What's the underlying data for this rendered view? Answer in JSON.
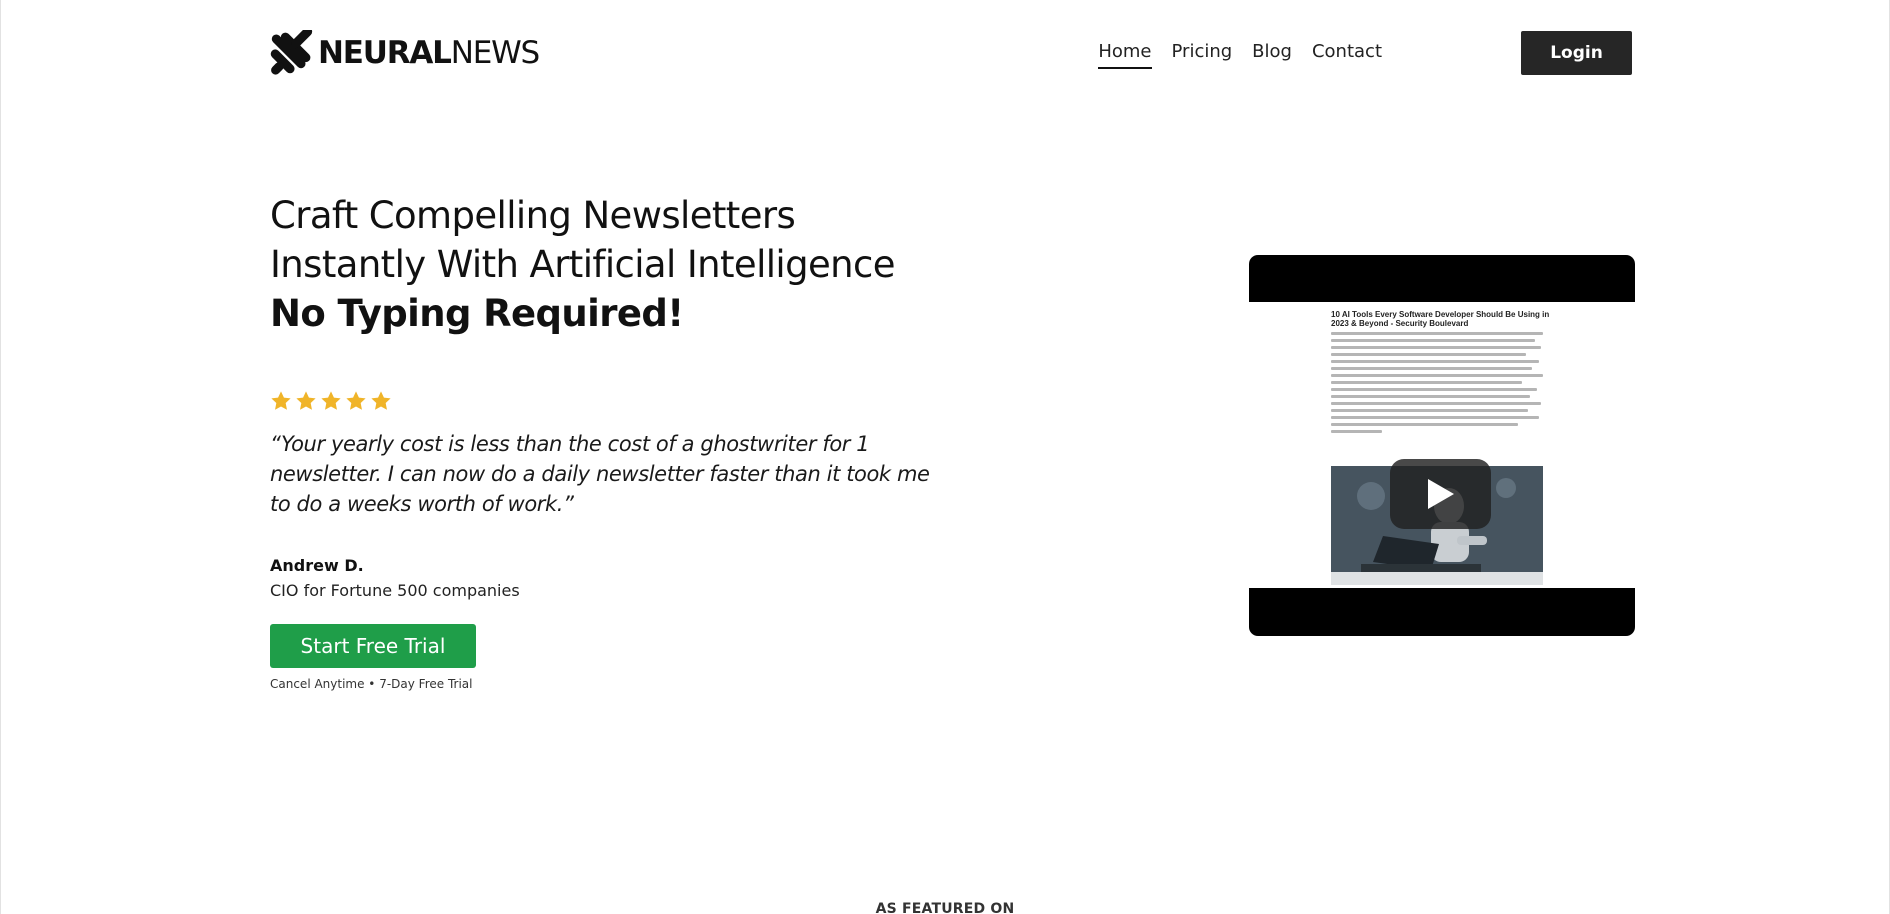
{
  "header": {
    "logo_text_strong": "NEURAL",
    "logo_text_light": "NEWS",
    "nav": [
      {
        "label": "Home",
        "active": true
      },
      {
        "label": "Pricing",
        "active": false
      },
      {
        "label": "Blog",
        "active": false
      },
      {
        "label": "Contact",
        "active": false
      }
    ],
    "login_label": "Login"
  },
  "hero": {
    "headline_line1": "Craft Compelling Newsletters",
    "headline_line2": "Instantly With Artificial Intelligence",
    "headline_emphasis": "No Typing Required!",
    "rating_stars": 5,
    "star_color": "#f0b429",
    "quote": "“Your yearly cost is less than the cost of a ghostwriter for 1 newsletter. I can now do a daily newsletter faster than it took me to do a weeks worth of work.”",
    "author_name": "Andrew D.",
    "author_role": "CIO for Fortune 500 companies",
    "cta_label": "Start Free Trial",
    "cta_color": "#1f9e49",
    "cta_note": "Cancel Anytime • 7-Day Free Trial"
  },
  "video": {
    "article_title": "10 AI Tools Every Software Developer Should Be Using in 2023 & Beyond - Security Boulevard",
    "play_icon": "play-icon"
  },
  "featured": {
    "label": "AS FEATURED ON"
  }
}
